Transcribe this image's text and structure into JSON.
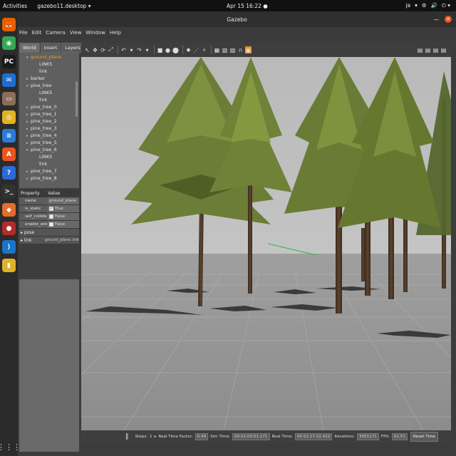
{
  "topbar": {
    "activities": "Activities",
    "app_menu": "gazebo11.desktop ▾",
    "clock": "Apr 15  16:22",
    "clock_dot": "●",
    "lang": "ja",
    "tray": [
      "▾",
      "⚙",
      "🔊",
      "⏻ ▾"
    ]
  },
  "dock": {
    "items": [
      {
        "name": "firefox-icon",
        "glyph": "🦊",
        "color": "#e66000"
      },
      {
        "name": "chrome-icon",
        "glyph": "◉",
        "color": "#34a853"
      },
      {
        "name": "pycharm-icon",
        "glyph": "PC",
        "color": "#1a1a1a"
      },
      {
        "name": "thunderbird-icon",
        "glyph": "✉",
        "color": "#1f6fd1"
      },
      {
        "name": "files-icon",
        "glyph": "▭",
        "color": "#8a6d5a"
      },
      {
        "name": "rhythmbox-icon",
        "glyph": "◎",
        "color": "#e2b323"
      },
      {
        "name": "writer-icon",
        "glyph": "≡",
        "color": "#2a7bd6"
      },
      {
        "name": "software-icon",
        "glyph": "A",
        "color": "#e95420"
      },
      {
        "name": "help-icon",
        "glyph": "?",
        "color": "#2b6ad6"
      },
      {
        "name": "terminal-icon",
        "glyph": ">_",
        "color": "#333"
      },
      {
        "name": "gazebo-icon",
        "glyph": "◆",
        "color": "#e36d2a"
      },
      {
        "name": "screen-recorder-icon",
        "glyph": "●",
        "color": "#b52b2b"
      },
      {
        "name": "vscode-icon",
        "glyph": "⟩",
        "color": "#1a75c8"
      },
      {
        "name": "notes-icon",
        "glyph": "▮",
        "color": "#e0b12a"
      }
    ],
    "apps_grid": "⋮⋮⋮"
  },
  "window": {
    "title": "Gazebo",
    "menu": [
      "File",
      "Edit",
      "Camera",
      "View",
      "Window",
      "Help"
    ]
  },
  "left_panel": {
    "tabs": [
      "World",
      "Insert",
      "Layers"
    ],
    "tree": [
      {
        "label": "ground_plane",
        "caret": "▾",
        "indent": 10,
        "highlight": true
      },
      {
        "label": "LINKS",
        "caret": "",
        "indent": 22,
        "highlight": false
      },
      {
        "label": "link",
        "caret": "",
        "indent": 22,
        "highlight": false
      },
      {
        "label": "barker",
        "caret": "▸",
        "indent": 10,
        "highlight": false
      },
      {
        "label": "pine_tree",
        "caret": "▾",
        "indent": 10,
        "highlight": false
      },
      {
        "label": "LINKS",
        "caret": "",
        "indent": 22,
        "highlight": false
      },
      {
        "label": "link",
        "caret": "",
        "indent": 22,
        "highlight": false
      },
      {
        "label": "pine_tree_0",
        "caret": "▸",
        "indent": 10,
        "highlight": false
      },
      {
        "label": "pine_tree_1",
        "caret": "▸",
        "indent": 10,
        "highlight": false
      },
      {
        "label": "pine_tree_2",
        "caret": "▸",
        "indent": 10,
        "highlight": false
      },
      {
        "label": "pine_tree_3",
        "caret": "▸",
        "indent": 10,
        "highlight": false
      },
      {
        "label": "pine_tree_4",
        "caret": "▸",
        "indent": 10,
        "highlight": false
      },
      {
        "label": "pine_tree_5",
        "caret": "▸",
        "indent": 10,
        "highlight": false
      },
      {
        "label": "pine_tree_6",
        "caret": "▾",
        "indent": 10,
        "highlight": false
      },
      {
        "label": "LINKS",
        "caret": "",
        "indent": 22,
        "highlight": false
      },
      {
        "label": "link",
        "caret": "",
        "indent": 22,
        "highlight": false
      },
      {
        "label": "pine_tree_7",
        "caret": "▸",
        "indent": 10,
        "highlight": false
      },
      {
        "label": "pine_tree_8",
        "caret": "▸",
        "indent": 10,
        "highlight": false
      }
    ],
    "props_header": {
      "property": "Property",
      "value": "Value"
    },
    "props": [
      {
        "key": "name",
        "value": "ground_plane",
        "check": false
      },
      {
        "key": "is_static",
        "value": "True",
        "check": true,
        "checked": true
      },
      {
        "key": "self_collide",
        "value": "False",
        "check": true,
        "checked": false
      },
      {
        "key": "enable_wind",
        "value": "False",
        "check": true,
        "checked": false
      }
    ],
    "groups": [
      {
        "key": "pose",
        "value": ""
      },
      {
        "key": "link",
        "value": "ground_plane::link"
      }
    ]
  },
  "toolbar": {
    "tools": [
      "↖",
      "✥",
      "⟳",
      "⤢",
      "|",
      "↶",
      "▾",
      "↷",
      "▾",
      "|",
      "■",
      "●",
      "⬤",
      "|",
      "✸",
      "⋰",
      "⚡",
      "|",
      "▦",
      "▧",
      "▨",
      "∩",
      "▣"
    ]
  },
  "bottombar": {
    "pause": "‖",
    "steps_label": "Steps:",
    "steps_value": "1",
    "rtf_label": "Real Time Factor:",
    "rtf_value": "0.49",
    "sim_time_label": "Sim Time:",
    "sim_time_value": "00 01:00:51.171",
    "real_time_label": "Real Time:",
    "real_time_value": "00 01:17:22.412",
    "iterations_label": "Iterations:",
    "iterations_value": "3051171",
    "fps_label": "FPS:",
    "fps_value": "62.51",
    "reset": "Reset Time"
  }
}
